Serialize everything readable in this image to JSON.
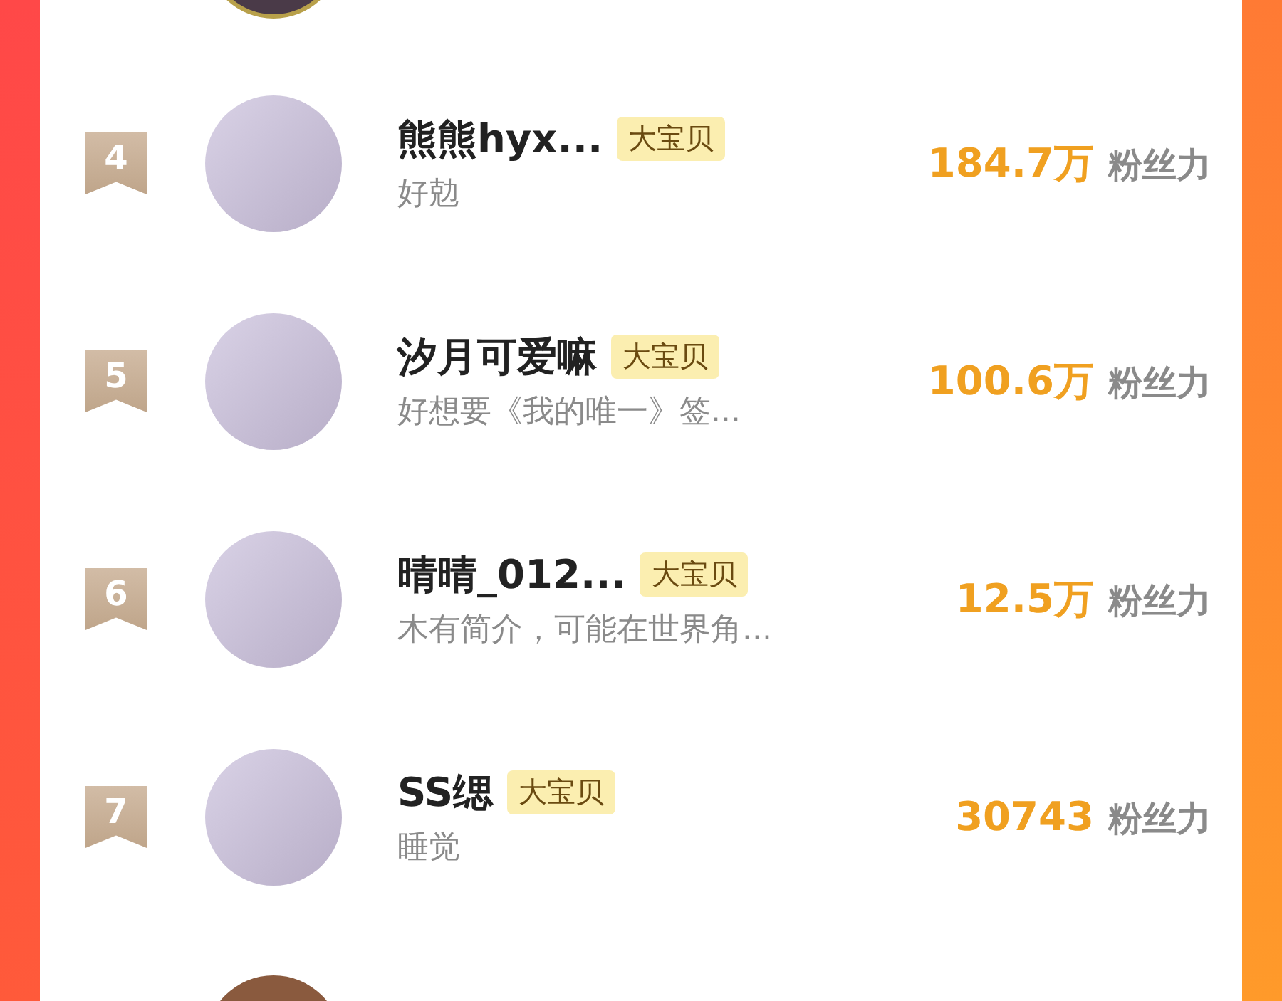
{
  "rows": [
    {
      "rank": "4",
      "name": "熊熊hyx...",
      "tag": "大宝贝",
      "bio": "好勊",
      "fans": "184.7万",
      "fans_unit": "粉丝力"
    },
    {
      "rank": "5",
      "name": "汐月可爱嘛",
      "tag": "大宝贝",
      "bio": "好想要《我的唯一》签...",
      "fans": "100.6万",
      "fans_unit": "粉丝力"
    },
    {
      "rank": "6",
      "name": "晴晴_012...",
      "tag": "大宝贝",
      "bio": "木有简介，可能在世界角...",
      "fans": "12.5万",
      "fans_unit": "粉丝力"
    },
    {
      "rank": "7",
      "name": "SS缌",
      "tag": "大宝贝",
      "bio": "睡觉",
      "fans": "30743",
      "fans_unit": "粉丝力"
    }
  ]
}
